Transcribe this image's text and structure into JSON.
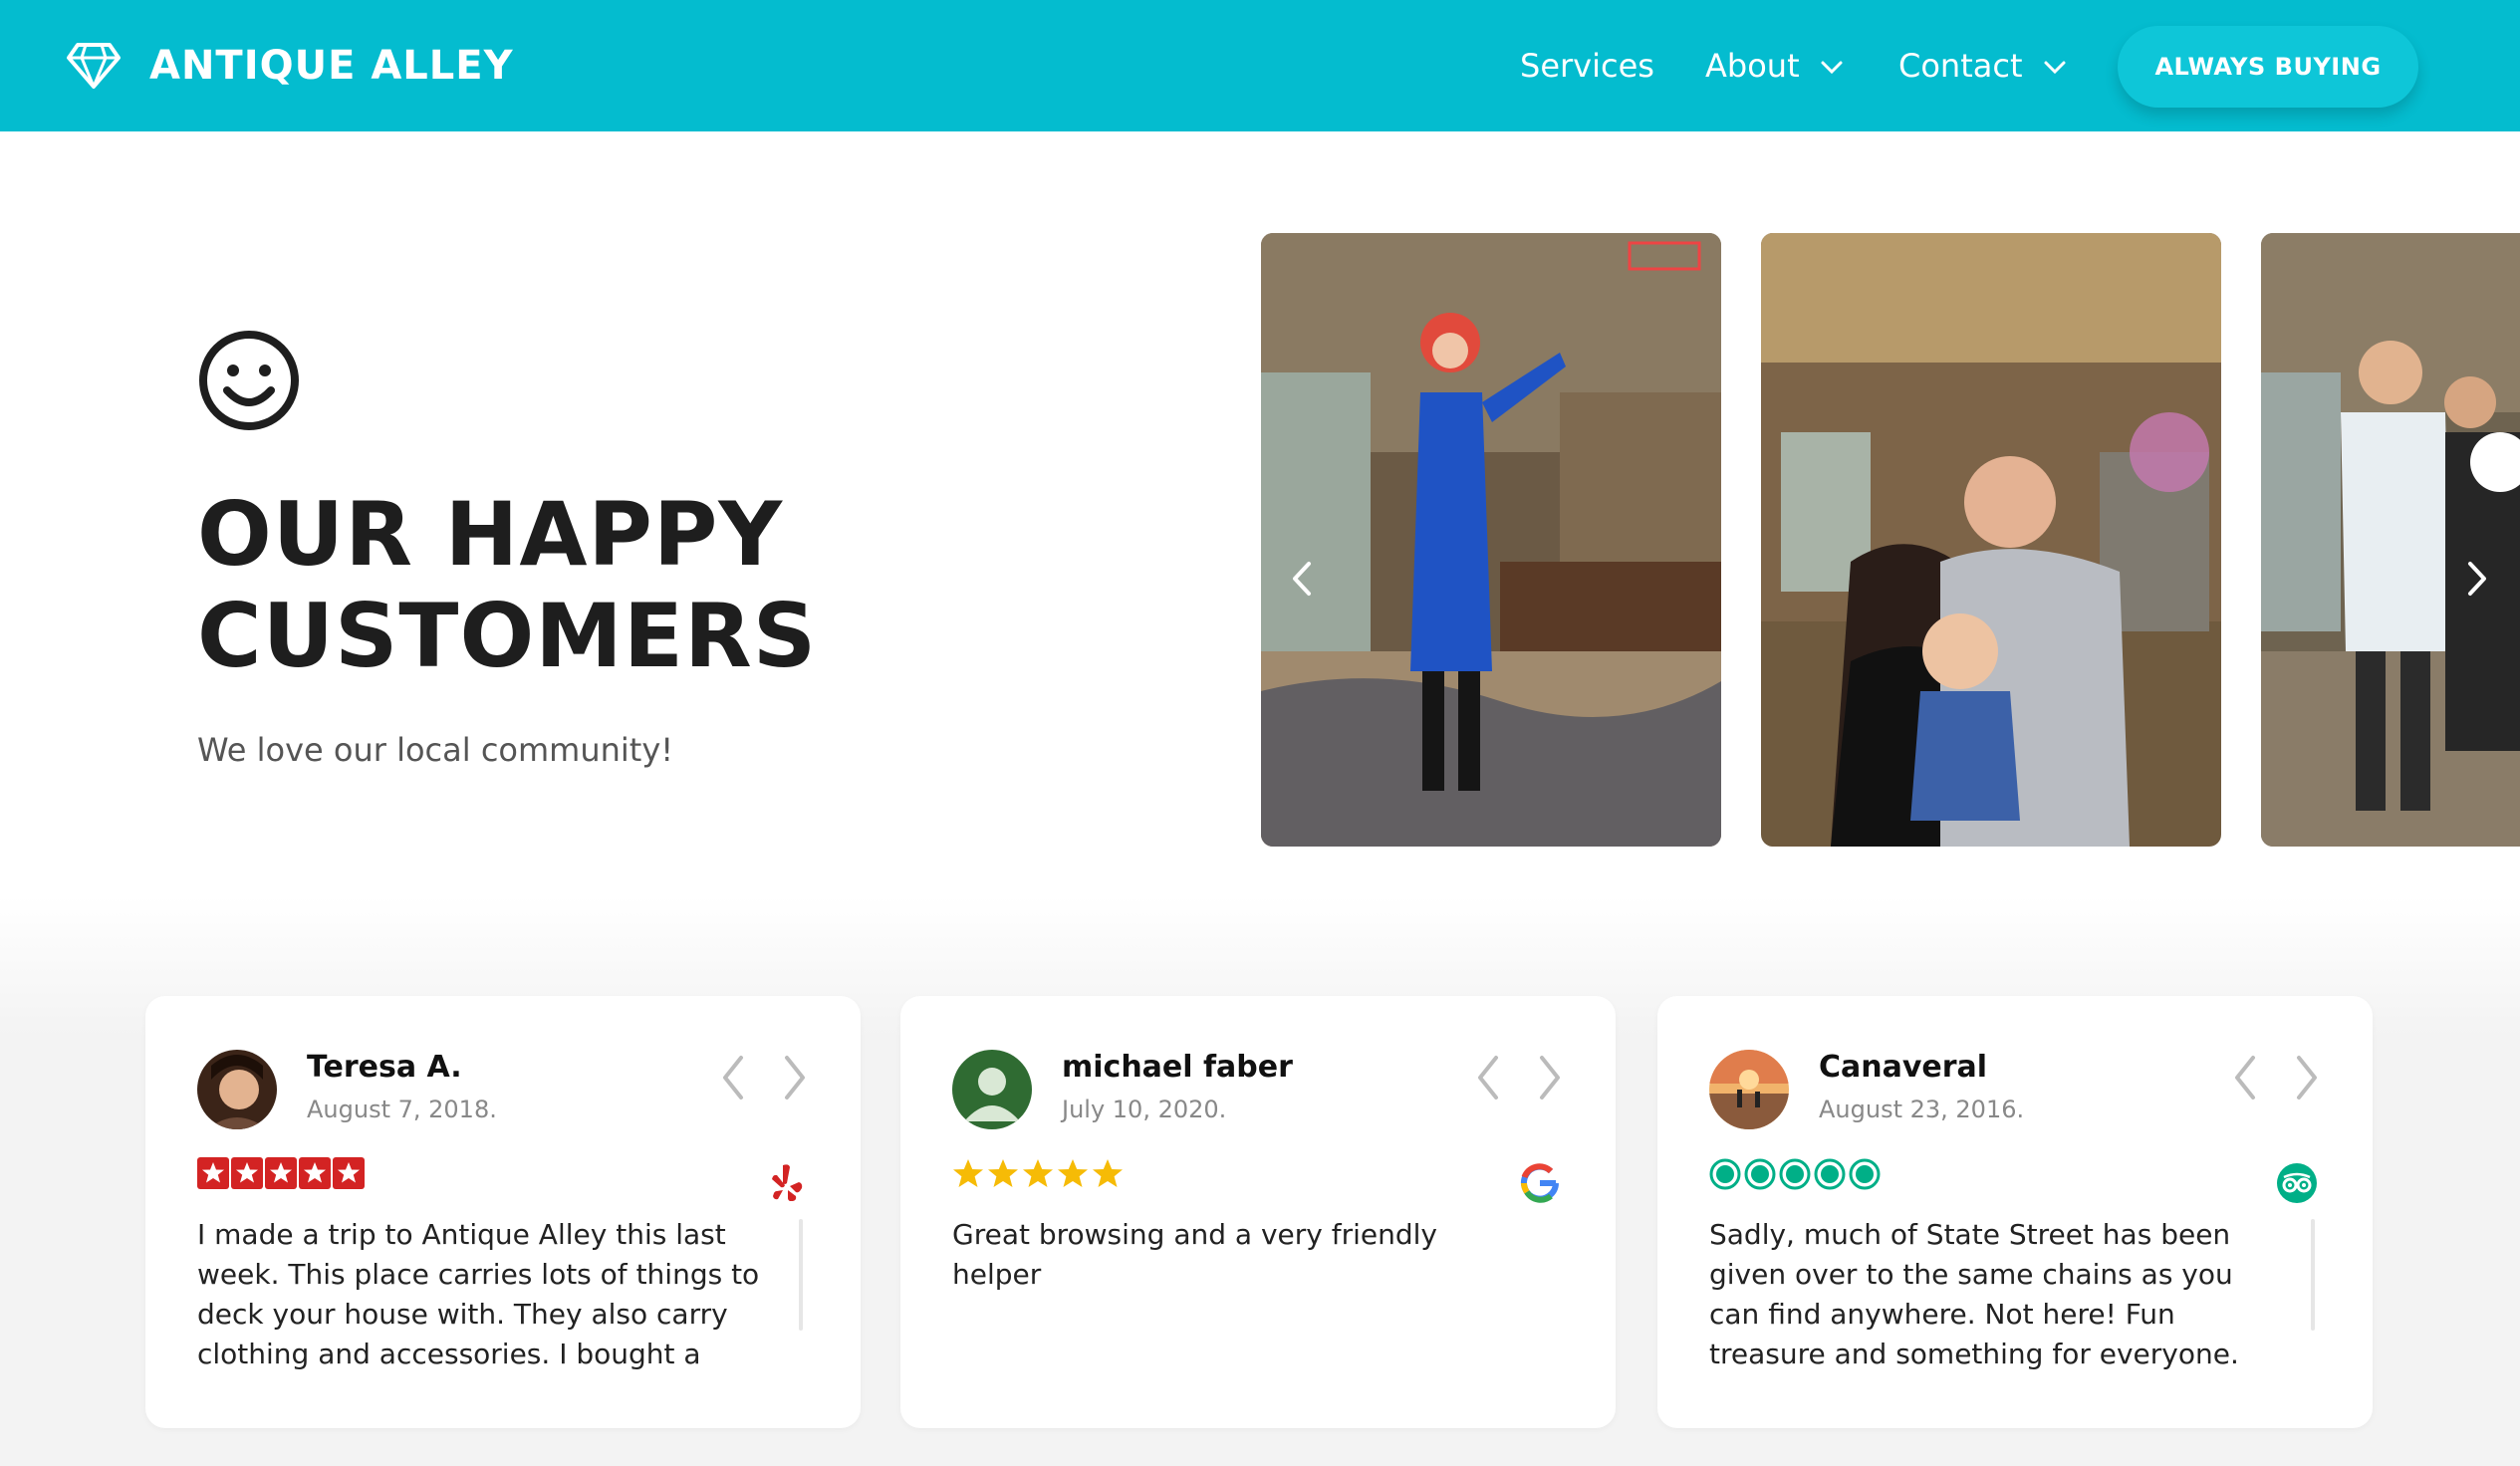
{
  "header": {
    "brand": "ANTIQUE ALLEY",
    "brand_icon": "diamond-icon",
    "nav": {
      "services": "Services",
      "about": "About",
      "contact": "Contact"
    },
    "cta": "ALWAYS BUYING"
  },
  "hero": {
    "icon": "smiley-icon",
    "title_line1": "OUR HAPPY",
    "title_line2": "CUSTOMERS",
    "subtitle": "We love our local community!"
  },
  "carousel": {
    "photos": [
      "customer-photo-1",
      "customer-photo-2",
      "customer-photo-3"
    ]
  },
  "reviews": [
    {
      "name": "Teresa A.",
      "date": "August 7, 2018.",
      "rating": 5,
      "source": "yelp",
      "text": "I made a trip to Antique Alley this last week. This place carries lots of things to deck your house with. They also carry clothing and accessories. I bought a silver photo frame"
    },
    {
      "name": "michael faber",
      "date": "July 10, 2020.",
      "rating": 5,
      "source": "google",
      "text": "Great browsing and a very friendly helper"
    },
    {
      "name": "Canaveral",
      "date": "August 23, 2016.",
      "rating": 5,
      "source": "tripadvisor",
      "text": "Sadly, much of State Street has been given over to the same chains as you can find anywhere. Not here! Fun treasure and something for everyone. Find a one of a kind"
    }
  ],
  "colors": {
    "brand": "#04bccf",
    "cta": "#0ec6d8",
    "yelp": "#d32323",
    "google_star": "#f6bb06",
    "tripadvisor": "#00af87"
  }
}
